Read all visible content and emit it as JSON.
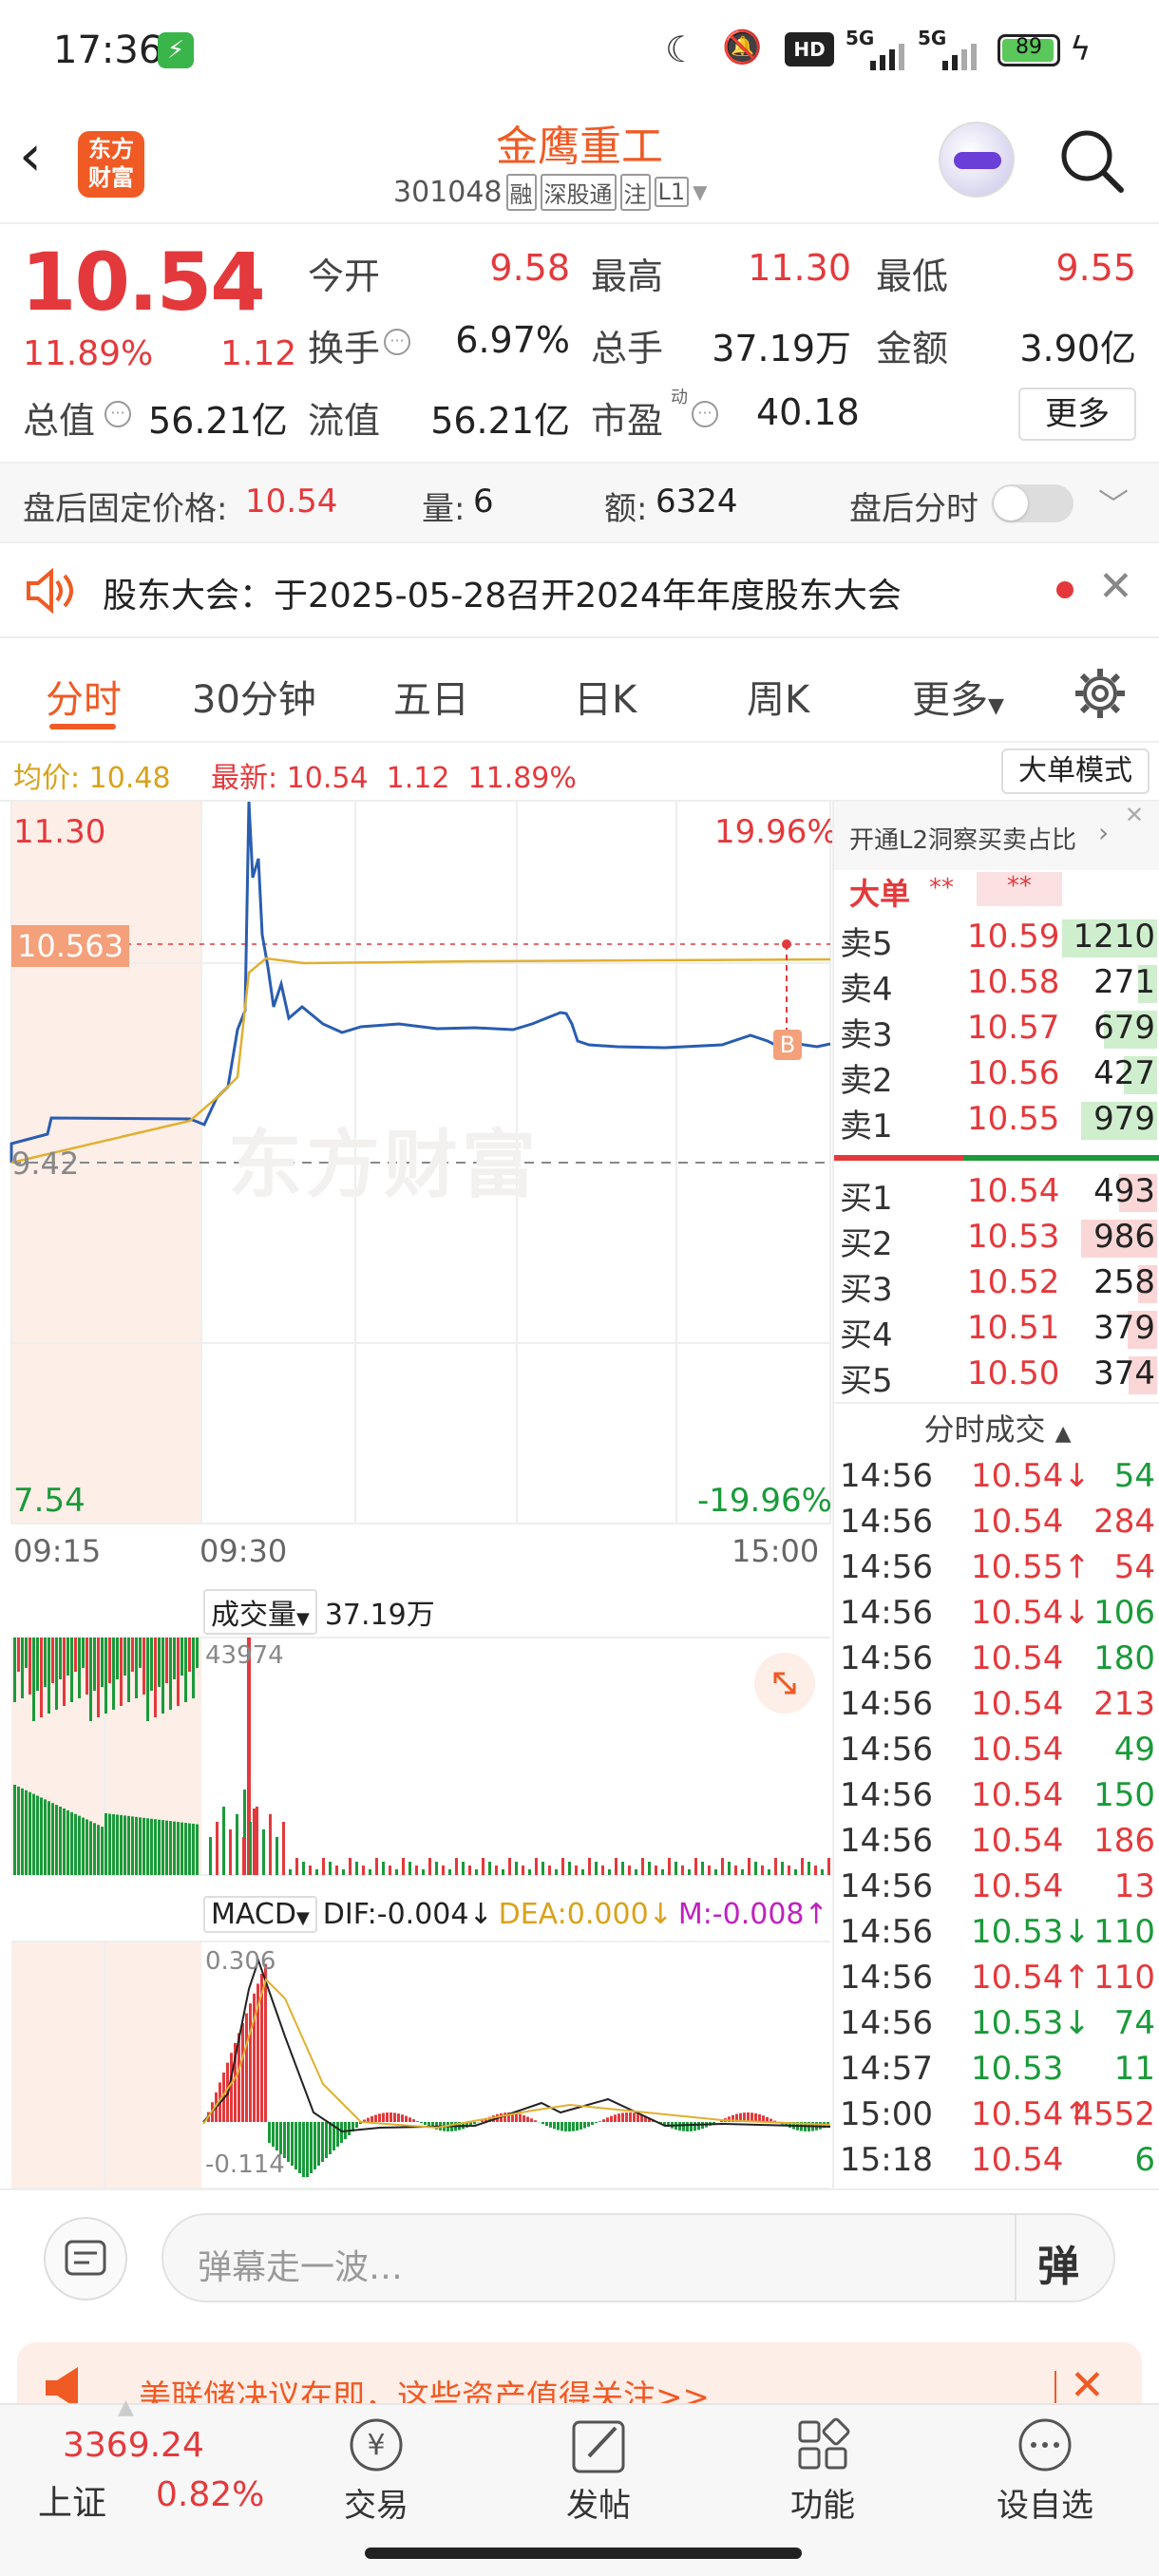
{
  "status_bar": {
    "time": "17:36",
    "battery": "89",
    "net1": "5G",
    "net2": "5G",
    "hd": "HD"
  },
  "header": {
    "app_logo": "东方财富",
    "name": "金鹰重工",
    "code": "301048",
    "tags": [
      "融",
      "深股通",
      "注",
      "L1"
    ]
  },
  "quote": {
    "price": "10.54",
    "pct": "11.89%",
    "chg": "1.12",
    "open_lbl": "今开",
    "open": "9.58",
    "high_lbl": "最高",
    "high": "11.30",
    "low_lbl": "最低",
    "low": "9.55",
    "turn_lbl": "换手",
    "turn": "6.97%",
    "vol_lbl": "总手",
    "vol": "37.19万",
    "amt_lbl": "金额",
    "amt": "3.90亿",
    "mcap_lbl": "总值",
    "mcap": "56.21亿",
    "float_lbl": "流值",
    "float": "56.21亿",
    "pe_lbl": "市盈",
    "pe_sup": "动",
    "pe": "40.18",
    "more": "更多"
  },
  "after": {
    "lbl": "盘后固定价格:",
    "price": "10.54",
    "vol_lbl": "量:",
    "vol": "6",
    "amt_lbl": "额:",
    "amt": "6324",
    "time_lbl": "盘后分时"
  },
  "notice": {
    "text": "股东大会：于2025-05-28召开2024年年度股东大会"
  },
  "tabs": [
    "分时",
    "30分钟",
    "五日",
    "日K",
    "周K",
    "更多"
  ],
  "chart": {
    "avg_lbl": "均价:",
    "avg": "10.48",
    "last_lbl": "最新:",
    "last": "10.54",
    "chg": "1.12",
    "pct": "11.89%",
    "big_mode": "大单模式",
    "top": "11.30",
    "top_pct": "19.96%",
    "cursor": "10.563",
    "mid": "9.42",
    "bot": "7.54",
    "bot_pct": "-19.96%",
    "t1": "09:15",
    "t2": "09:30",
    "t3": "15:00",
    "watermark": "东方财富",
    "b_marker": "B",
    "vol_btn": "成交量",
    "vol_total": "37.19万",
    "vol_max": "43974",
    "macd_btn": "MACD",
    "dif": "DIF:-0.004",
    "dea": "DEA:0.000",
    "m": "M:-0.008",
    "macd_top": "0.306",
    "macd_bot": "-0.114"
  },
  "l2": {
    "promo": "开通L2洞察买卖占比",
    "big": "大单",
    "stars1": "**",
    "stars2": "**",
    "asks": [
      {
        "l": "卖5",
        "p": "10.59",
        "v": "1210",
        "f": 1
      },
      {
        "l": "卖4",
        "p": "10.58",
        "v": "271",
        "f": 0.2
      },
      {
        "l": "卖3",
        "p": "10.57",
        "v": "679",
        "f": 0.56
      },
      {
        "l": "卖2",
        "p": "10.56",
        "v": "427",
        "f": 0.35
      },
      {
        "l": "卖1",
        "p": "10.55",
        "v": "979",
        "f": 0.8
      }
    ],
    "bids": [
      {
        "l": "买1",
        "p": "10.54",
        "v": "493",
        "f": 0.4
      },
      {
        "l": "买2",
        "p": "10.53",
        "v": "986",
        "f": 0.8
      },
      {
        "l": "买3",
        "p": "10.52",
        "v": "258",
        "f": 0.2
      },
      {
        "l": "买4",
        "p": "10.51",
        "v": "379",
        "f": 0.31
      },
      {
        "l": "买5",
        "p": "10.50",
        "v": "374",
        "f": 0.3
      }
    ],
    "ticks_title": "分时成交",
    "ticks": [
      [
        "14:56",
        "10.54",
        "↓",
        "54",
        "g"
      ],
      [
        "14:56",
        "10.54",
        "",
        "284",
        "r"
      ],
      [
        "14:56",
        "10.55",
        "↑",
        "54",
        "r"
      ],
      [
        "14:56",
        "10.54",
        "↓",
        "106",
        "g"
      ],
      [
        "14:56",
        "10.54",
        "",
        "180",
        "g"
      ],
      [
        "14:56",
        "10.54",
        "",
        "213",
        "r"
      ],
      [
        "14:56",
        "10.54",
        "",
        "49",
        "g"
      ],
      [
        "14:56",
        "10.54",
        "",
        "150",
        "g"
      ],
      [
        "14:56",
        "10.54",
        "",
        "186",
        "r"
      ],
      [
        "14:56",
        "10.54",
        "",
        "13",
        "r"
      ],
      [
        "14:56",
        "10.53",
        "↓",
        "110",
        "g"
      ],
      [
        "14:56",
        "10.54",
        "↑",
        "110",
        "r"
      ],
      [
        "14:56",
        "10.53",
        "↓",
        "74",
        "g"
      ],
      [
        "14:57",
        "10.53",
        "",
        "11",
        "g"
      ],
      [
        "15:00",
        "10.54",
        "↑",
        "4552",
        "r"
      ],
      [
        "15:18",
        "10.54",
        "",
        "6",
        "g"
      ]
    ]
  },
  "comment": {
    "placeholder": "弹幕走一波…",
    "danmu": "弹"
  },
  "banner": {
    "text": "美联储决议在即，这些资产值得关注>>"
  },
  "bottom": {
    "index_val": "3369.24",
    "index_name": "上证",
    "index_pct": "0.82%",
    "items": [
      "交易",
      "发帖",
      "功能",
      "设自选"
    ]
  },
  "colors": {
    "up": "#e4393c",
    "down": "#1a9a3a",
    "accent": "#f05a24",
    "avg": "#e0b030",
    "line": "#2a5db0"
  }
}
